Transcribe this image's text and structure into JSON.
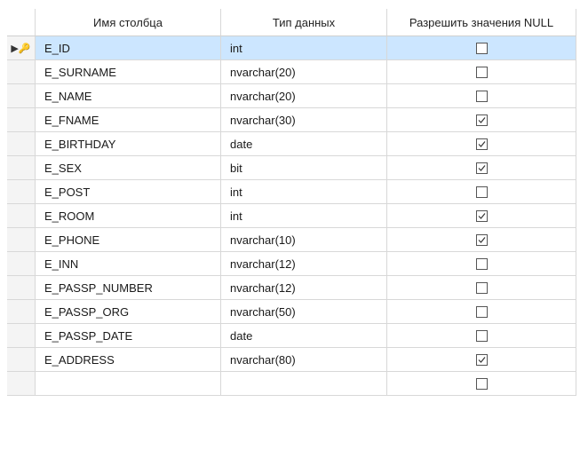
{
  "headers": {
    "column_name": "Имя столбца",
    "data_type": "Тип данных",
    "allow_nulls": "Разрешить значения NULL"
  },
  "active_row_indicator": "▶🔑",
  "rows": [
    {
      "name": "E_ID",
      "type": "int",
      "allow_null": false,
      "primary_key": true
    },
    {
      "name": "E_SURNAME",
      "type": "nvarchar(20)",
      "allow_null": false
    },
    {
      "name": "E_NAME",
      "type": "nvarchar(20)",
      "allow_null": false
    },
    {
      "name": "E_FNAME",
      "type": "nvarchar(30)",
      "allow_null": true
    },
    {
      "name": "E_BIRTHDAY",
      "type": "date",
      "allow_null": true
    },
    {
      "name": "E_SEX",
      "type": "bit",
      "allow_null": true
    },
    {
      "name": "E_POST",
      "type": "int",
      "allow_null": false
    },
    {
      "name": "E_ROOM",
      "type": "int",
      "allow_null": true
    },
    {
      "name": "E_PHONE",
      "type": "nvarchar(10)",
      "allow_null": true
    },
    {
      "name": "E_INN",
      "type": "nvarchar(12)",
      "allow_null": false
    },
    {
      "name": "E_PASSP_NUMBER",
      "type": "nvarchar(12)",
      "allow_null": false
    },
    {
      "name": "E_PASSP_ORG",
      "type": "nvarchar(50)",
      "allow_null": false
    },
    {
      "name": "E_PASSP_DATE",
      "type": "date",
      "allow_null": false
    },
    {
      "name": "E_ADDRESS",
      "type": "nvarchar(80)",
      "allow_null": true
    },
    {
      "name": "",
      "type": "",
      "allow_null": false
    }
  ],
  "colors": {
    "selected_row": "#cce6ff",
    "grid_line": "#d8d8d8"
  }
}
